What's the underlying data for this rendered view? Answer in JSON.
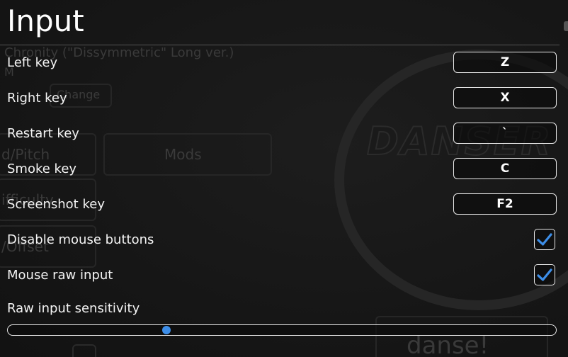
{
  "background": {
    "song_title": "Chronity (\"Dissymmetric\" Long ver.)",
    "stray_text": "M",
    "change_button": "Change",
    "speed_pitch": "d/Pitch",
    "mods_button": "Mods",
    "difficulty": "ifficulty",
    "offset": "/Offset",
    "logo": "DANSER",
    "danse_button": "danse!"
  },
  "panel": {
    "title": "Input",
    "keybinds": [
      {
        "label": "Left key",
        "key": "Z"
      },
      {
        "label": "Right key",
        "key": "X"
      },
      {
        "label": "Restart key",
        "key": "`"
      },
      {
        "label": "Smoke key",
        "key": "C"
      },
      {
        "label": "Screenshot key",
        "key": "F2"
      }
    ],
    "toggles": [
      {
        "label": "Disable mouse buttons",
        "checked": true
      },
      {
        "label": "Mouse raw input",
        "checked": true
      }
    ],
    "sensitivity": {
      "label": "Raw input sensitivity",
      "value_fraction": 0.29
    }
  },
  "colors": {
    "accent": "#3d8ee8",
    "text": "#f4f4f4",
    "border": "#e8e8e8",
    "background": "#161616"
  },
  "icons": {
    "check": "check-icon"
  }
}
